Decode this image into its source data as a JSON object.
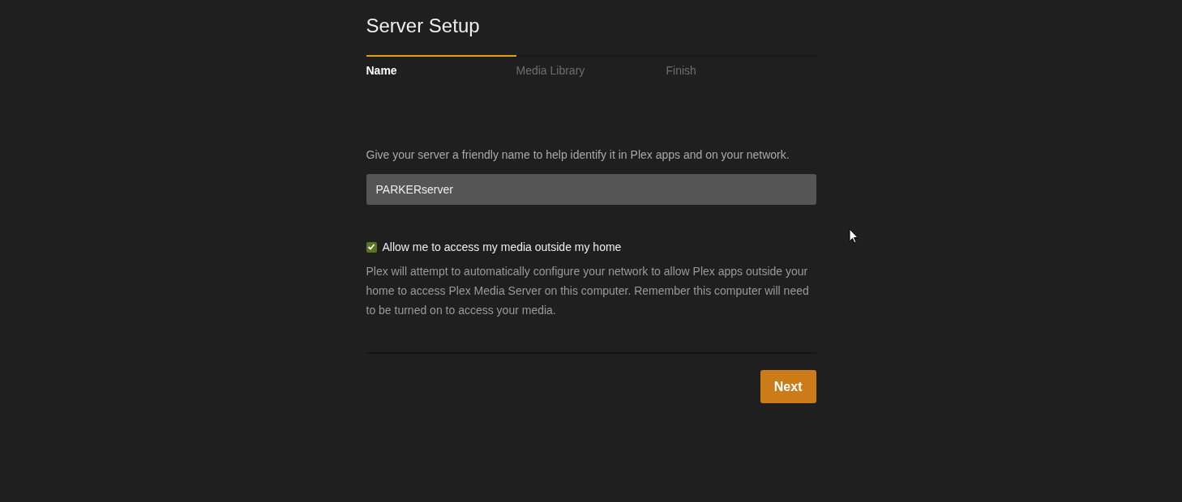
{
  "title": "Server Setup",
  "steps": [
    {
      "label": "Name",
      "selected": true
    },
    {
      "label": "Media Library",
      "selected": false
    },
    {
      "label": "Finish",
      "selected": false
    }
  ],
  "description": "Give your server a friendly name to help identify it in Plex apps and on your network.",
  "server_name": {
    "value": "PARKERserver"
  },
  "remote_access": {
    "label": "Allow me to access my media outside my home",
    "checked": true
  },
  "remote_access_note": "Plex will attempt to automatically configure your network to allow Plex apps outside your home to access Plex Media Server on this computer. Remember this computer will need to be turned on to access your media.",
  "buttons": [
    {
      "label": "Next",
      "kind": "primary"
    }
  ]
}
